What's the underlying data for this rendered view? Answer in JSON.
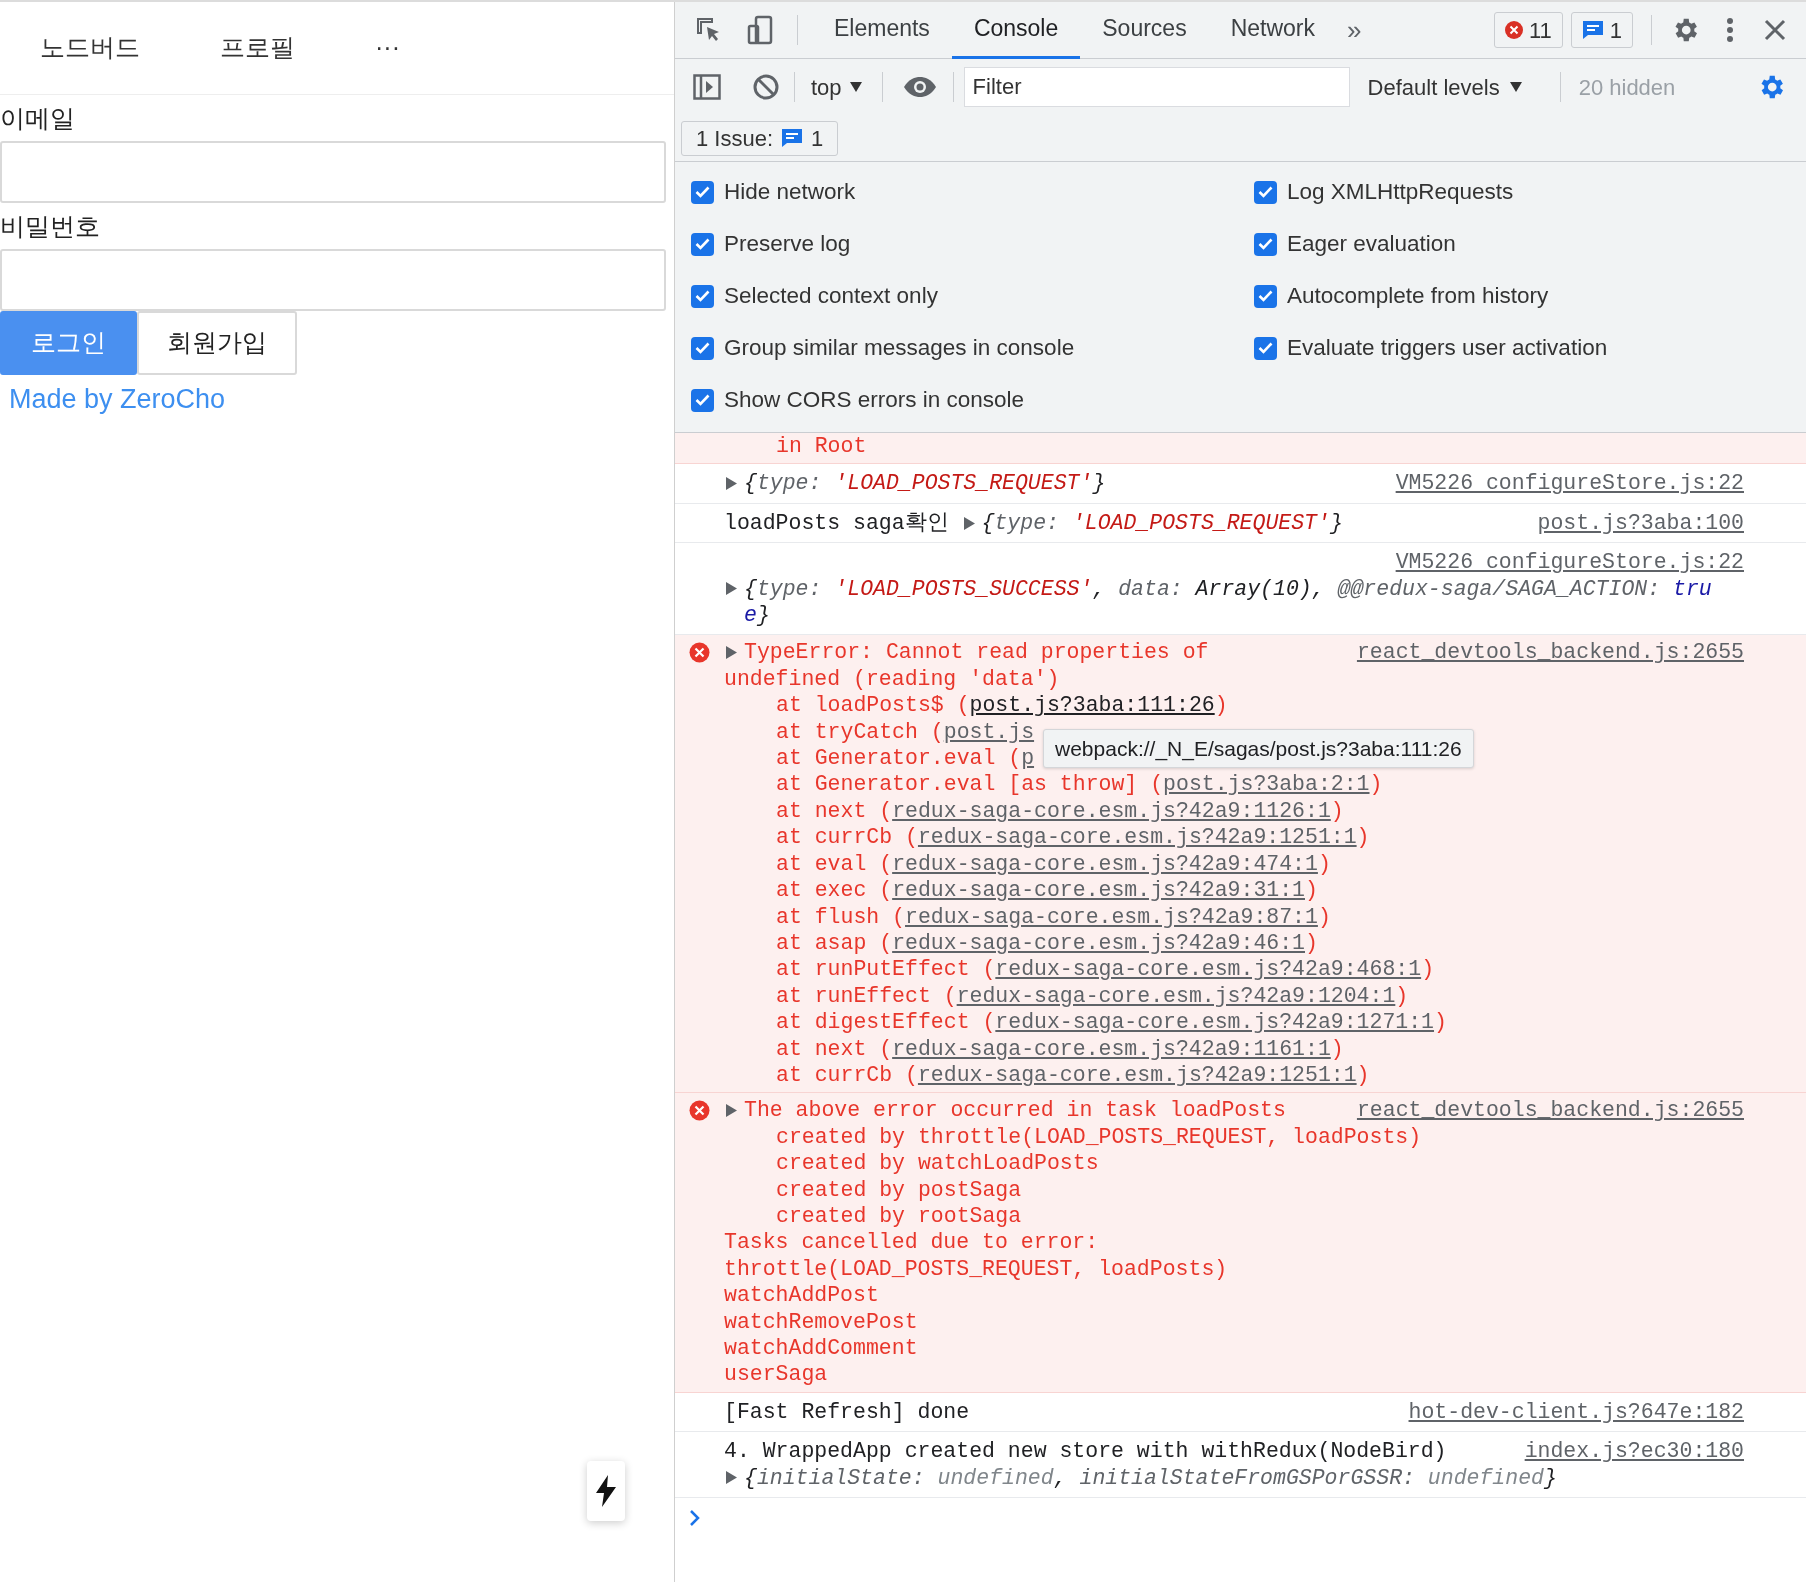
{
  "app": {
    "nav": [
      {
        "label": "노드버드"
      },
      {
        "label": "프로필"
      },
      {
        "label": "···"
      }
    ],
    "fields": [
      {
        "label": "이메일"
      },
      {
        "label": "비밀번호"
      }
    ],
    "buttons": [
      {
        "label": "로그인",
        "kind": "primary"
      },
      {
        "label": "회원가입",
        "kind": "default"
      }
    ],
    "footer_link": "Made by ZeroCho"
  },
  "devtools": {
    "tabs": [
      {
        "label": "Elements",
        "selected": false
      },
      {
        "label": "Console",
        "selected": true
      },
      {
        "label": "Sources",
        "selected": false
      },
      {
        "label": "Network",
        "selected": false
      }
    ],
    "more": "»",
    "error_count": "11",
    "issue_count": "1",
    "toolbar": {
      "context": "top",
      "filter_placeholder": "Filter",
      "levels": "Default levels",
      "hidden": "20 hidden"
    },
    "issues": {
      "label": "1 Issue:",
      "count": "1"
    },
    "settings": [
      {
        "label": "Hide network",
        "checked": true
      },
      {
        "label": "Log XMLHttpRequests",
        "checked": true
      },
      {
        "label": "Preserve log",
        "checked": true
      },
      {
        "label": "Eager evaluation",
        "checked": true
      },
      {
        "label": "Selected context only",
        "checked": true
      },
      {
        "label": "Autocomplete from history",
        "checked": true
      },
      {
        "label": "Group similar messages in console",
        "checked": true
      },
      {
        "label": "Evaluate triggers user activation",
        "checked": true
      },
      {
        "label": "Show CORS errors in console",
        "checked": true
      }
    ],
    "messages": [
      {
        "kind": "error_cont",
        "lines": [
          {
            "kind": "stack",
            "segs": [
              {
                "kind": "err",
                "t": "in Root"
              }
            ]
          }
        ]
      },
      {
        "kind": "log",
        "source": "VM5226 configureStore.js:22",
        "lines": [
          {
            "kind": "plain",
            "segs": [
              {
                "kind": "tri"
              },
              {
                "kind": "obj",
                "t": "{"
              },
              {
                "kind": "key",
                "t": "type: "
              },
              {
                "kind": "str",
                "t": "'LOAD_POSTS_REQUEST'"
              },
              {
                "kind": "obj",
                "t": "}"
              }
            ]
          }
        ]
      },
      {
        "kind": "log",
        "source": "post.js?3aba:100",
        "lines": [
          {
            "kind": "plain",
            "segs": [
              {
                "kind": "plain",
                "t": "loadPosts saga확인 "
              },
              {
                "kind": "tri"
              },
              {
                "kind": "obj",
                "t": "{"
              },
              {
                "kind": "key",
                "t": "type: "
              },
              {
                "kind": "str",
                "t": "'LOAD_POSTS_REQUEST'"
              },
              {
                "kind": "obj",
                "t": "}"
              }
            ]
          }
        ]
      },
      {
        "kind": "log_wrapped",
        "source": "VM5226 configureStore.js:22",
        "lines": [
          {
            "kind": "plain",
            "segs": [
              {
                "kind": "tri"
              },
              {
                "kind": "obj",
                "t": "{"
              },
              {
                "kind": "key",
                "t": "type: "
              },
              {
                "kind": "str",
                "t": "'LOAD_POSTS_SUCCESS'"
              },
              {
                "kind": "obj",
                "t": ", "
              },
              {
                "kind": "key",
                "t": "data: "
              },
              {
                "kind": "obj",
                "t": "Array(10), "
              },
              {
                "kind": "key",
                "t": "@@redux-saga/SAGA_ACTION: "
              },
              {
                "kind": "kw",
                "t": "tru"
              }
            ]
          },
          {
            "kind": "wrap",
            "segs": [
              {
                "kind": "kw",
                "t": "e"
              },
              {
                "kind": "obj",
                "t": "}"
              }
            ]
          }
        ]
      },
      {
        "kind": "error",
        "source": "react_devtools_backend.js:2655",
        "lines": [
          {
            "kind": "plain",
            "segs": [
              {
                "kind": "tri"
              },
              {
                "kind": "err",
                "t": "TypeError: Cannot read properties of"
              }
            ]
          },
          {
            "kind": "plain",
            "segs": [
              {
                "kind": "err",
                "t": "undefined (reading 'data')"
              }
            ]
          },
          {
            "kind": "stack",
            "segs": [
              {
                "kind": "err",
                "t": "at loadPosts$ ("
              },
              {
                "kind": "link_hover",
                "t": "post.js?3aba:111:26"
              },
              {
                "kind": "err",
                "t": ")"
              }
            ]
          },
          {
            "kind": "stack",
            "segs": [
              {
                "kind": "err",
                "t": "at tryCatch ("
              },
              {
                "kind": "link",
                "t": "post.js"
              }
            ]
          },
          {
            "kind": "stack",
            "segs": [
              {
                "kind": "err",
                "t": "at Generator.eval ("
              },
              {
                "kind": "link",
                "t": "p"
              }
            ]
          },
          {
            "kind": "stack",
            "segs": [
              {
                "kind": "err",
                "t": "at Generator.eval [as throw] ("
              },
              {
                "kind": "link",
                "t": "post.js?3aba:2:1"
              },
              {
                "kind": "err",
                "t": ")"
              }
            ]
          },
          {
            "kind": "stack",
            "segs": [
              {
                "kind": "err",
                "t": "at next ("
              },
              {
                "kind": "link",
                "t": "redux-saga-core.esm.js?42a9:1126:1"
              },
              {
                "kind": "err",
                "t": ")"
              }
            ]
          },
          {
            "kind": "stack",
            "segs": [
              {
                "kind": "err",
                "t": "at currCb ("
              },
              {
                "kind": "link",
                "t": "redux-saga-core.esm.js?42a9:1251:1"
              },
              {
                "kind": "err",
                "t": ")"
              }
            ]
          },
          {
            "kind": "stack",
            "segs": [
              {
                "kind": "err",
                "t": "at eval ("
              },
              {
                "kind": "link",
                "t": "redux-saga-core.esm.js?42a9:474:1"
              },
              {
                "kind": "err",
                "t": ")"
              }
            ]
          },
          {
            "kind": "stack",
            "segs": [
              {
                "kind": "err",
                "t": "at exec ("
              },
              {
                "kind": "link",
                "t": "redux-saga-core.esm.js?42a9:31:1"
              },
              {
                "kind": "err",
                "t": ")"
              }
            ]
          },
          {
            "kind": "stack",
            "segs": [
              {
                "kind": "err",
                "t": "at flush ("
              },
              {
                "kind": "link",
                "t": "redux-saga-core.esm.js?42a9:87:1"
              },
              {
                "kind": "err",
                "t": ")"
              }
            ]
          },
          {
            "kind": "stack",
            "segs": [
              {
                "kind": "err",
                "t": "at asap ("
              },
              {
                "kind": "link",
                "t": "redux-saga-core.esm.js?42a9:46:1"
              },
              {
                "kind": "err",
                "t": ")"
              }
            ]
          },
          {
            "kind": "stack",
            "segs": [
              {
                "kind": "err",
                "t": "at runPutEffect ("
              },
              {
                "kind": "link",
                "t": "redux-saga-core.esm.js?42a9:468:1"
              },
              {
                "kind": "err",
                "t": ")"
              }
            ]
          },
          {
            "kind": "stack",
            "segs": [
              {
                "kind": "err",
                "t": "at runEffect ("
              },
              {
                "kind": "link",
                "t": "redux-saga-core.esm.js?42a9:1204:1"
              },
              {
                "kind": "err",
                "t": ")"
              }
            ]
          },
          {
            "kind": "stack",
            "segs": [
              {
                "kind": "err",
                "t": "at digestEffect ("
              },
              {
                "kind": "link",
                "t": "redux-saga-core.esm.js?42a9:1271:1"
              },
              {
                "kind": "err",
                "t": ")"
              }
            ]
          },
          {
            "kind": "stack",
            "segs": [
              {
                "kind": "err",
                "t": "at next ("
              },
              {
                "kind": "link",
                "t": "redux-saga-core.esm.js?42a9:1161:1"
              },
              {
                "kind": "err",
                "t": ")"
              }
            ]
          },
          {
            "kind": "stack",
            "segs": [
              {
                "kind": "err",
                "t": "at currCb ("
              },
              {
                "kind": "link",
                "t": "redux-saga-core.esm.js?42a9:1251:1"
              },
              {
                "kind": "err",
                "t": ")"
              }
            ]
          }
        ],
        "tooltip": "webpack://_N_E/sagas/post.js?3aba:111:26"
      },
      {
        "kind": "error",
        "source": "react_devtools_backend.js:2655",
        "lines": [
          {
            "kind": "plain",
            "segs": [
              {
                "kind": "tri"
              },
              {
                "kind": "err",
                "t": "The above error occurred in task loadPosts"
              }
            ]
          },
          {
            "kind": "stack",
            "segs": [
              {
                "kind": "err",
                "t": "created by throttle(LOAD_POSTS_REQUEST, loadPosts)"
              }
            ]
          },
          {
            "kind": "stack",
            "segs": [
              {
                "kind": "err",
                "t": "created by watchLoadPosts"
              }
            ]
          },
          {
            "kind": "stack",
            "segs": [
              {
                "kind": "err",
                "t": "created by postSaga"
              }
            ]
          },
          {
            "kind": "stack",
            "segs": [
              {
                "kind": "err",
                "t": "created by rootSaga"
              }
            ]
          },
          {
            "kind": "plain",
            "segs": [
              {
                "kind": "err",
                "t": "Tasks cancelled due to error:"
              }
            ]
          },
          {
            "kind": "plain",
            "segs": [
              {
                "kind": "err",
                "t": "throttle(LOAD_POSTS_REQUEST, loadPosts)"
              }
            ]
          },
          {
            "kind": "plain",
            "segs": [
              {
                "kind": "err",
                "t": "watchAddPost"
              }
            ]
          },
          {
            "kind": "plain",
            "segs": [
              {
                "kind": "err",
                "t": "watchRemovePost"
              }
            ]
          },
          {
            "kind": "plain",
            "segs": [
              {
                "kind": "err",
                "t": "watchAddComment"
              }
            ]
          },
          {
            "kind": "plain",
            "segs": [
              {
                "kind": "err",
                "t": "userSaga"
              }
            ]
          }
        ]
      },
      {
        "kind": "log",
        "source": "hot-dev-client.js?647e:182",
        "lines": [
          {
            "kind": "plain",
            "segs": [
              {
                "kind": "plain",
                "t": "[Fast Refresh] done"
              }
            ]
          }
        ]
      },
      {
        "kind": "log",
        "source": "index.js?ec30:180",
        "lines": [
          {
            "kind": "plain",
            "segs": [
              {
                "kind": "plain",
                "t": "4. WrappedApp created new store with withRedux(NodeBird)"
              }
            ]
          },
          {
            "kind": "plain",
            "segs": [
              {
                "kind": "tri"
              },
              {
                "kind": "obj",
                "t": "{"
              },
              {
                "kind": "key",
                "t": "initialState: "
              },
              {
                "kind": "u",
                "t": "undefined"
              },
              {
                "kind": "obj",
                "t": ", "
              },
              {
                "kind": "key",
                "t": "initialStateFromGSPorGSSR: "
              },
              {
                "kind": "u",
                "t": "undefined"
              },
              {
                "kind": "obj",
                "t": "}"
              }
            ]
          }
        ]
      }
    ]
  }
}
